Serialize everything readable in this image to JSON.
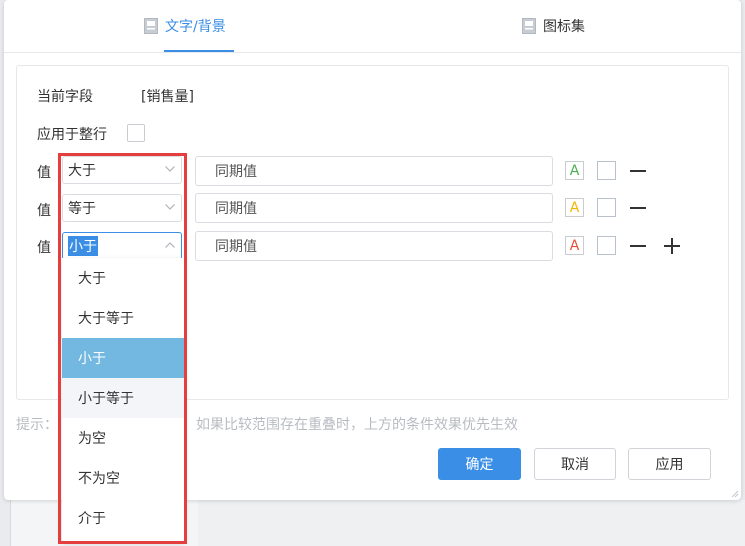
{
  "tabs": [
    {
      "label": "文字/背景",
      "icon": "book-icon",
      "active": true
    },
    {
      "label": "图标集",
      "icon": "book-icon",
      "active": false
    }
  ],
  "current_field": {
    "label": "当前字段",
    "value": "[销售量]"
  },
  "apply_whole_row": {
    "label": "应用于整行",
    "checked": false
  },
  "rules": [
    {
      "label": "值",
      "operator": "大于",
      "value": "同期值",
      "font_color_letter": "A",
      "font_color": "#4caf50"
    },
    {
      "label": "值",
      "operator": "等于",
      "value": "同期值",
      "font_color_letter": "A",
      "font_color": "#f5b400"
    },
    {
      "label": "值",
      "operator": "小于",
      "value": "同期值",
      "font_color_letter": "A",
      "font_color": "#e0533a"
    }
  ],
  "dropdown": {
    "options": [
      "大于",
      "大于等于",
      "小于",
      "小于等于",
      "为空",
      "不为空",
      "介于"
    ],
    "selected": "小于",
    "hovered": "小于等于"
  },
  "tip": {
    "prefix": "提示：",
    "text": "如果比较范围存在重叠时，上方的条件效果优先生效"
  },
  "buttons": {
    "ok": "确定",
    "cancel": "取消",
    "apply": "应用"
  },
  "colors": {
    "accent": "#3a8ee6",
    "highlight_border": "#e43e3e",
    "selected_option": "#72b8e0"
  }
}
